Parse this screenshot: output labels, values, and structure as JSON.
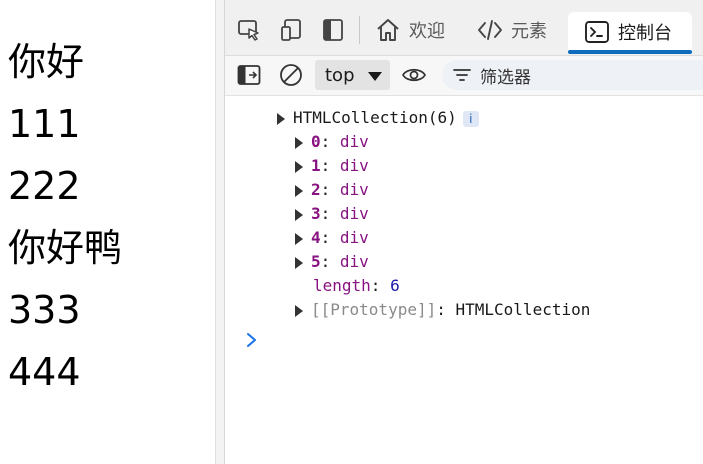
{
  "page": {
    "lines": [
      "你好",
      "111",
      "222",
      "你好鸭",
      "333",
      "444"
    ]
  },
  "devtools": {
    "tabs": {
      "welcome": "欢迎",
      "elements": "元素",
      "console": "控制台"
    },
    "toolbar": {
      "context": "top",
      "filter_placeholder": "筛选器"
    },
    "console": {
      "header": "HTMLCollection(6)",
      "info_badge": "i",
      "items": [
        {
          "index": "0",
          "value": "div"
        },
        {
          "index": "1",
          "value": "div"
        },
        {
          "index": "2",
          "value": "div"
        },
        {
          "index": "3",
          "value": "div"
        },
        {
          "index": "4",
          "value": "div"
        },
        {
          "index": "5",
          "value": "div"
        }
      ],
      "length_key": "length",
      "length_value": "6",
      "prototype_key": "[[Prototype]]",
      "prototype_value": "HTMLCollection"
    },
    "colors": {
      "accent": "#0f6cbd",
      "property": "#881280",
      "number": "#1a1aa6"
    }
  }
}
